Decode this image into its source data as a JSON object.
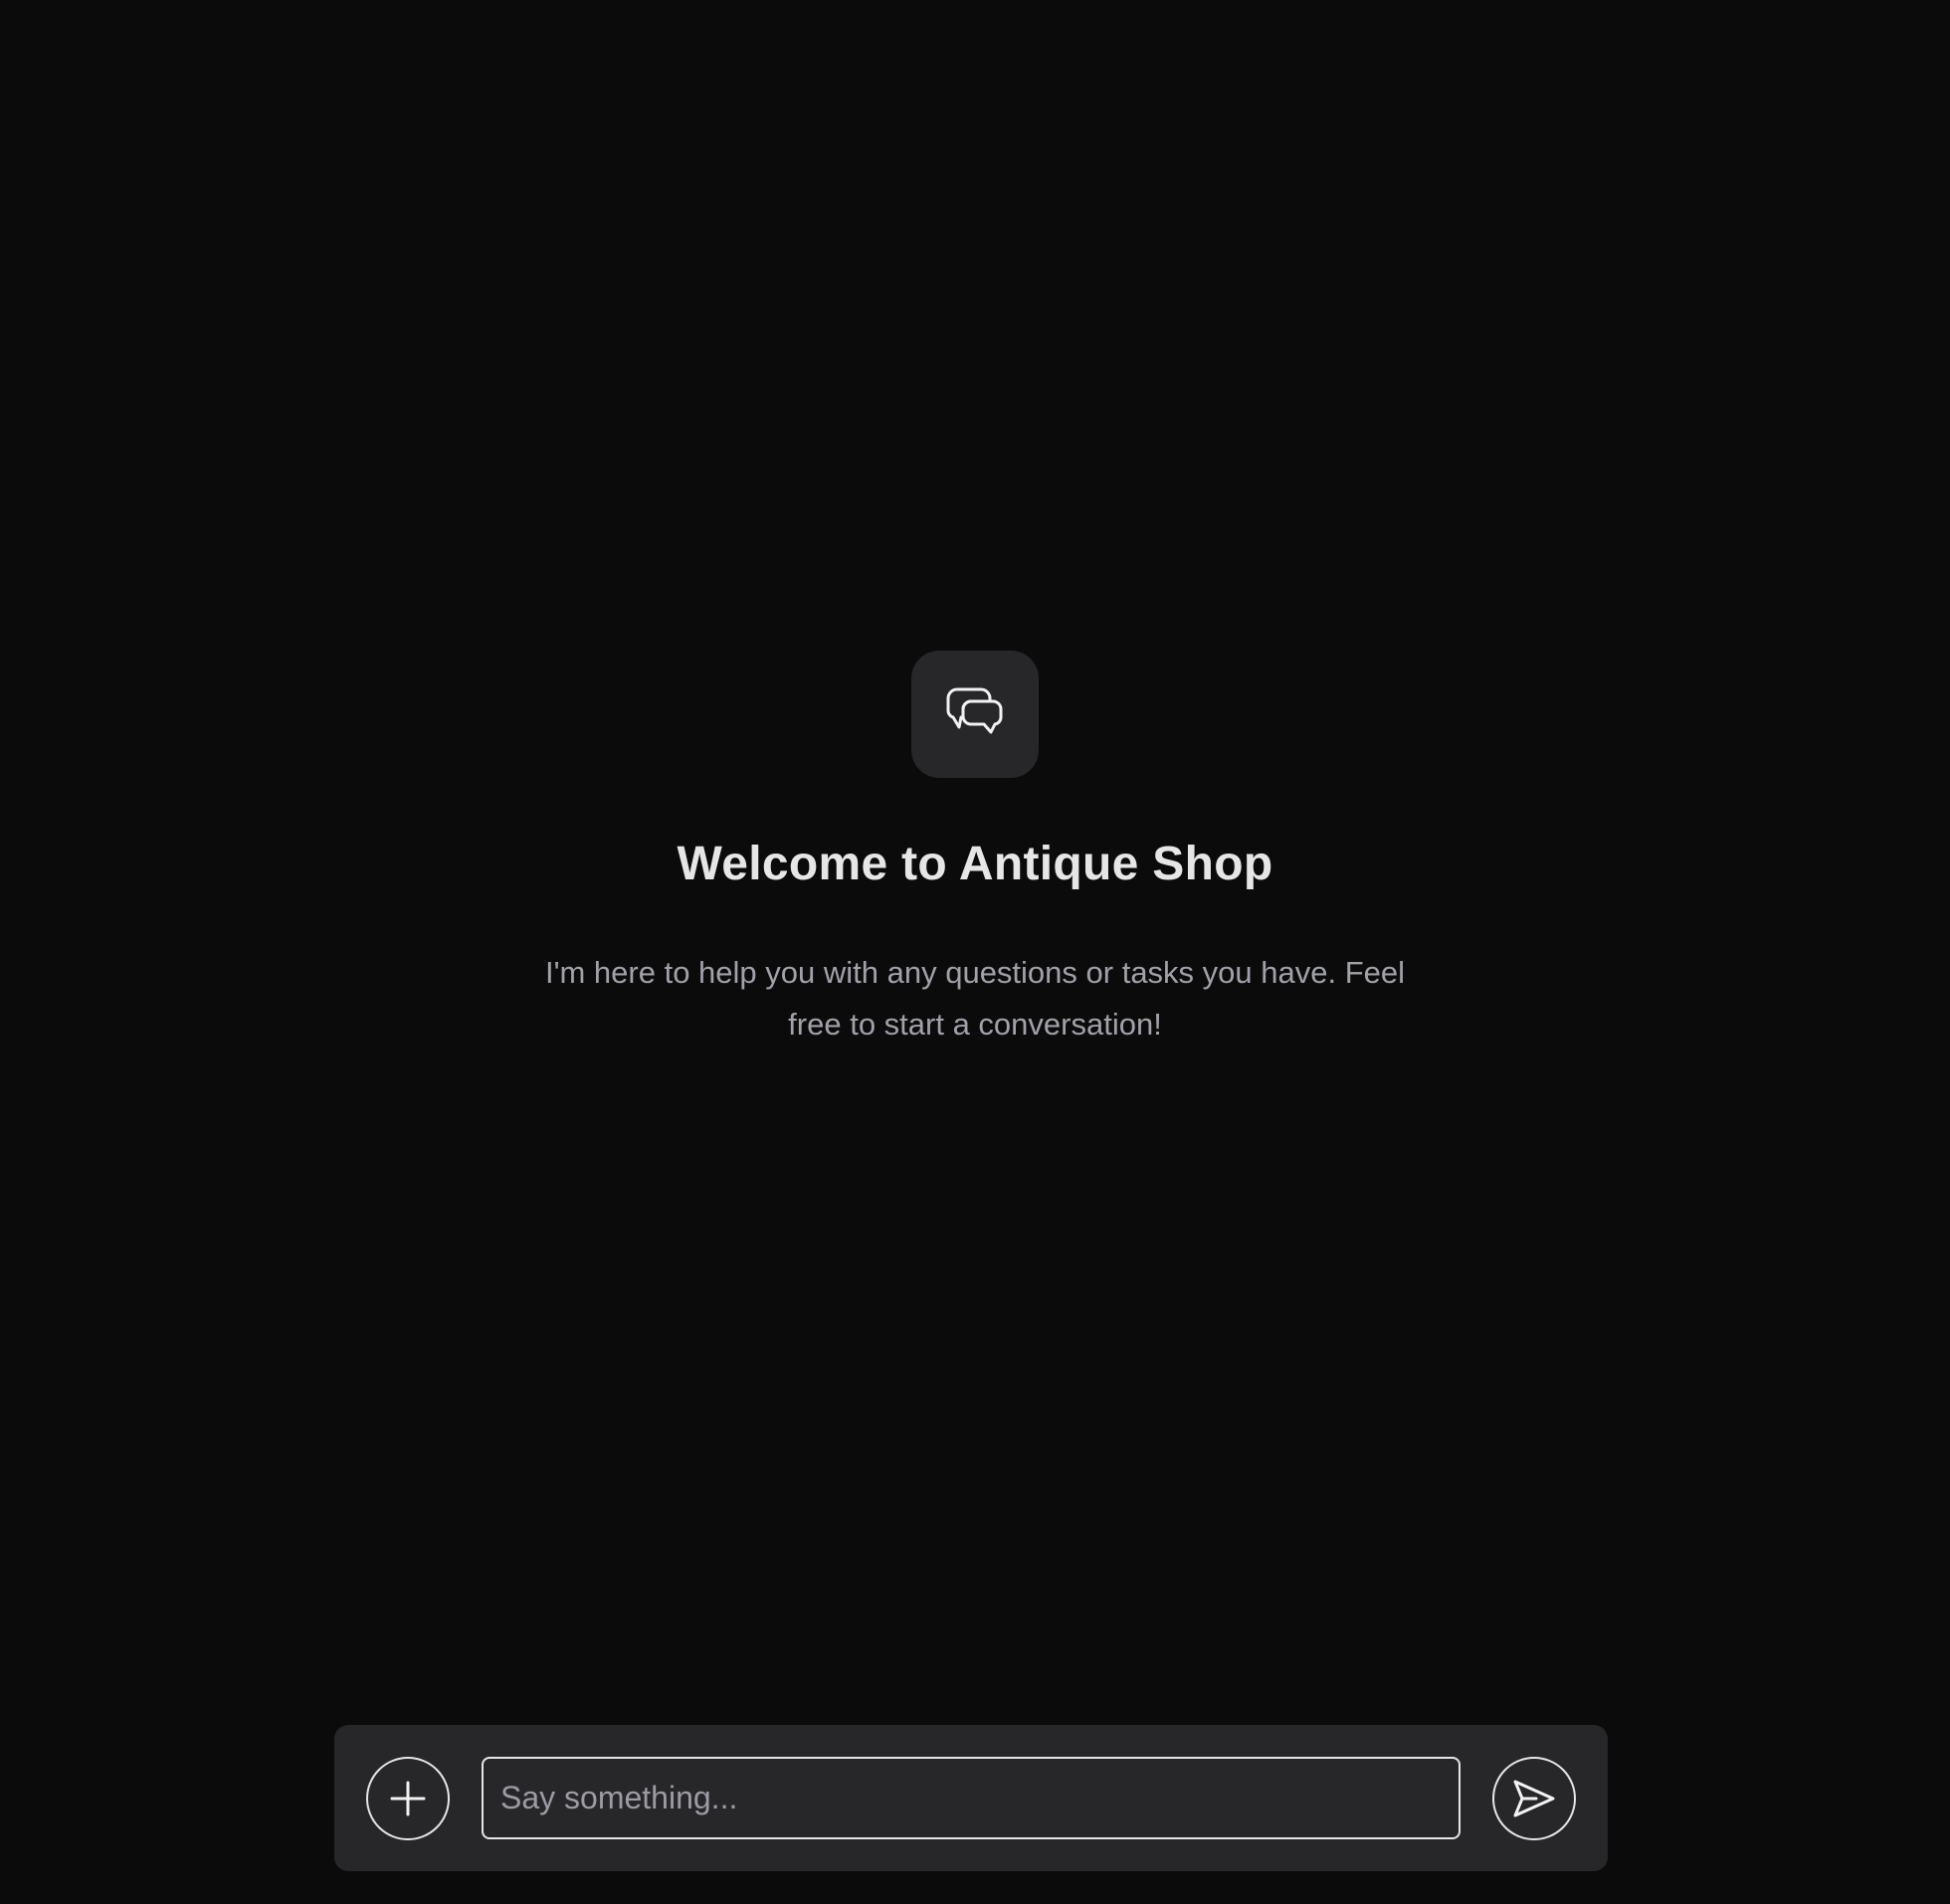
{
  "welcome": {
    "icon": "chat-bubbles-icon",
    "title": "Welcome to Antique Shop",
    "subtitle": "I'm here to help you with any questions or tasks you have. Feel free to start a conversation!"
  },
  "composer": {
    "add_icon": "plus-icon",
    "input_value": "",
    "input_placeholder": "Say something...",
    "send_icon": "send-icon"
  },
  "colors": {
    "background": "#0b0b0b",
    "surface": "#27272a",
    "text_primary": "#e6e6e6",
    "text_secondary": "#a1a1aa"
  }
}
